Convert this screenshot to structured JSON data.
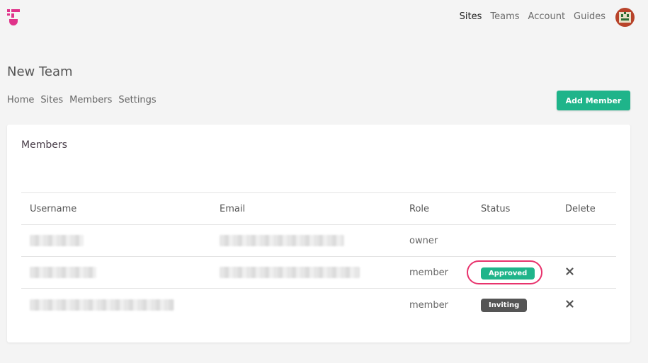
{
  "topnav": {
    "items": [
      "Sites",
      "Teams",
      "Account",
      "Guides"
    ],
    "active": "Sites"
  },
  "page": {
    "title": "New Team"
  },
  "subnav": {
    "items": [
      "Home",
      "Sites",
      "Members",
      "Settings"
    ]
  },
  "actions": {
    "add_member_label": "Add Member"
  },
  "members_card": {
    "title": "Members",
    "columns": [
      "Username",
      "Email",
      "Role",
      "Status",
      "Delete"
    ],
    "rows": [
      {
        "role": "owner",
        "status": ""
      },
      {
        "role": "member",
        "status": "Approved"
      },
      {
        "role": "member",
        "status": "Inviting"
      }
    ]
  },
  "colors": {
    "accent": "#1fb48a",
    "brand_logo": "#e0338a",
    "highlight_ring": "#e8336d",
    "inviting_badge": "#555555"
  },
  "icons": {
    "logo": "brand-logo-icon",
    "delete": "close-icon",
    "avatar": "user-avatar"
  }
}
